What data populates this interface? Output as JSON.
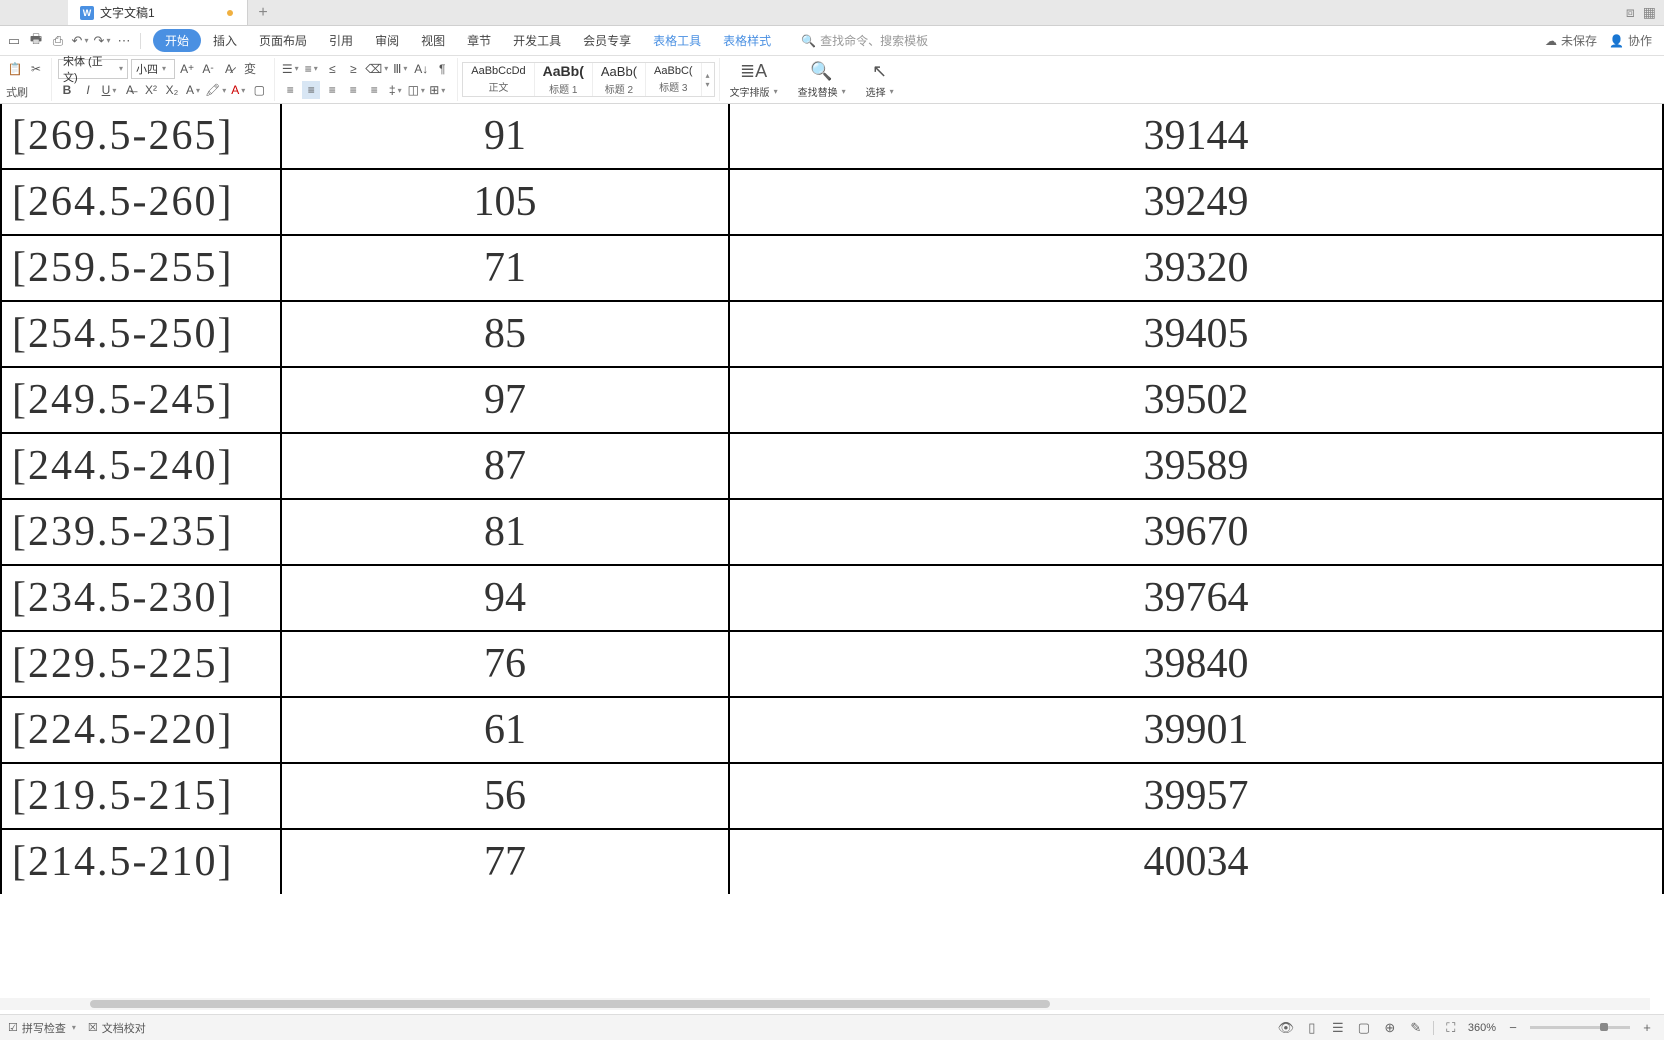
{
  "tabs": {
    "doc_title": "文字文稿1",
    "new_tab": "+"
  },
  "quick_access": {
    "labels": [
      "⬚",
      "🖶",
      "⎙",
      "↶",
      "↷"
    ]
  },
  "menu": {
    "items": [
      "开始",
      "插入",
      "页面布局",
      "引用",
      "审阅",
      "视图",
      "章节",
      "开发工具",
      "会员专享",
      "表格工具",
      "表格样式"
    ],
    "active_index": 0,
    "search_placeholder": "查找命令、搜索模板",
    "right": {
      "unsaved": "未保存",
      "collab": "协作"
    }
  },
  "ribbon": {
    "brush": "式刷",
    "font_name": "宋体 (正文)",
    "font_size": "小四",
    "styles": [
      {
        "preview": "AaBbCcDd",
        "label": "正文"
      },
      {
        "preview": "AaBb(",
        "label": "标题 1",
        "bold": true
      },
      {
        "preview": "AaBb(",
        "label": "标题 2"
      },
      {
        "preview": "AaBbC(",
        "label": "标题 3"
      }
    ],
    "layout_btn": "文字排版",
    "find_btn": "查找替换",
    "select_btn": "选择"
  },
  "table_rows": [
    {
      "c1": "[269.5-265]",
      "c2": "91",
      "c3": "39144",
      "cutoff": true
    },
    {
      "c1": "[264.5-260]",
      "c2": "105",
      "c3": "39249"
    },
    {
      "c1": "[259.5-255]",
      "c2": "71",
      "c3": "39320"
    },
    {
      "c1": "[254.5-250]",
      "c2": "85",
      "c3": "39405"
    },
    {
      "c1": "[249.5-245]",
      "c2": "97",
      "c3": "39502"
    },
    {
      "c1": "[244.5-240]",
      "c2": "87",
      "c3": "39589"
    },
    {
      "c1": "[239.5-235]",
      "c2": "81",
      "c3": "39670"
    },
    {
      "c1": "[234.5-230]",
      "c2": "94",
      "c3": "39764"
    },
    {
      "c1": "[229.5-225]",
      "c2": "76",
      "c3": "39840"
    },
    {
      "c1": "[224.5-220]",
      "c2": "61",
      "c3": "39901"
    },
    {
      "c1": "[219.5-215]",
      "c2": "56",
      "c3": "39957"
    },
    {
      "c1": "[214.5-210]",
      "c2": "77",
      "c3": "40034"
    }
  ],
  "status": {
    "spell": "拼写检查",
    "compare": "文档校对",
    "zoom": "360%"
  }
}
